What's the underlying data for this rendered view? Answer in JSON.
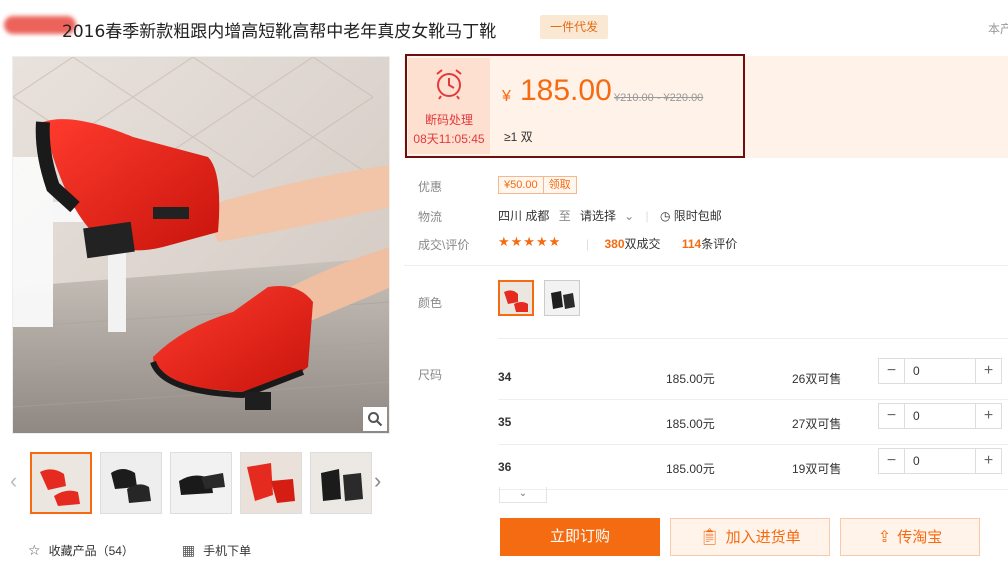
{
  "product": {
    "title": "2016春季新款粗跟内增高短靴高帮中老年真皮女靴马丁靴",
    "badge": "一件代发",
    "more_link": "本产"
  },
  "gallery": {
    "zoom_icon": "magnifier-icon",
    "prev_icon": "chevron-left-icon",
    "next_icon": "chevron-right-icon",
    "favorite_label": "收藏产品（54）",
    "mobile_order_label": "手机下单"
  },
  "promotion": {
    "icon": "alarm-clock-icon",
    "label": "断码处理",
    "countdown": "08天11:05:45"
  },
  "price": {
    "currency": "¥",
    "value": "185.00",
    "original": "¥210.00 - ¥220.00",
    "moq": "≥1 双"
  },
  "info": {
    "coupon_label": "优惠",
    "coupon_amount": "¥50.00",
    "coupon_action": "领取",
    "logistics_label": "物流",
    "logistics_from": "四川 成都",
    "logistics_to_word": "至",
    "logistics_dest": "请选择",
    "free_ship": "限时包邮",
    "deal_label": "成交\\评价",
    "stars": "★★★★★",
    "deal_count": "380",
    "deal_unit": "双成交",
    "review_count": "114",
    "review_unit": "条评价",
    "color_label": "颜色",
    "size_label": "尺码"
  },
  "sizes": [
    {
      "size": "34",
      "price": "185.00元",
      "stock": "26双可售",
      "qty": "0"
    },
    {
      "size": "35",
      "price": "185.00元",
      "stock": "27双可售",
      "qty": "0"
    },
    {
      "size": "36",
      "price": "185.00元",
      "stock": "19双可售",
      "qty": "0"
    }
  ],
  "actions": {
    "buy": "立即订购",
    "cart": "加入进货单",
    "taobao": "传淘宝"
  },
  "colors": {
    "accent": "#f56b11",
    "promo_red": "#e4393c",
    "highlight_border": "#6e0f0f",
    "price_bg": "#fff2e8"
  }
}
